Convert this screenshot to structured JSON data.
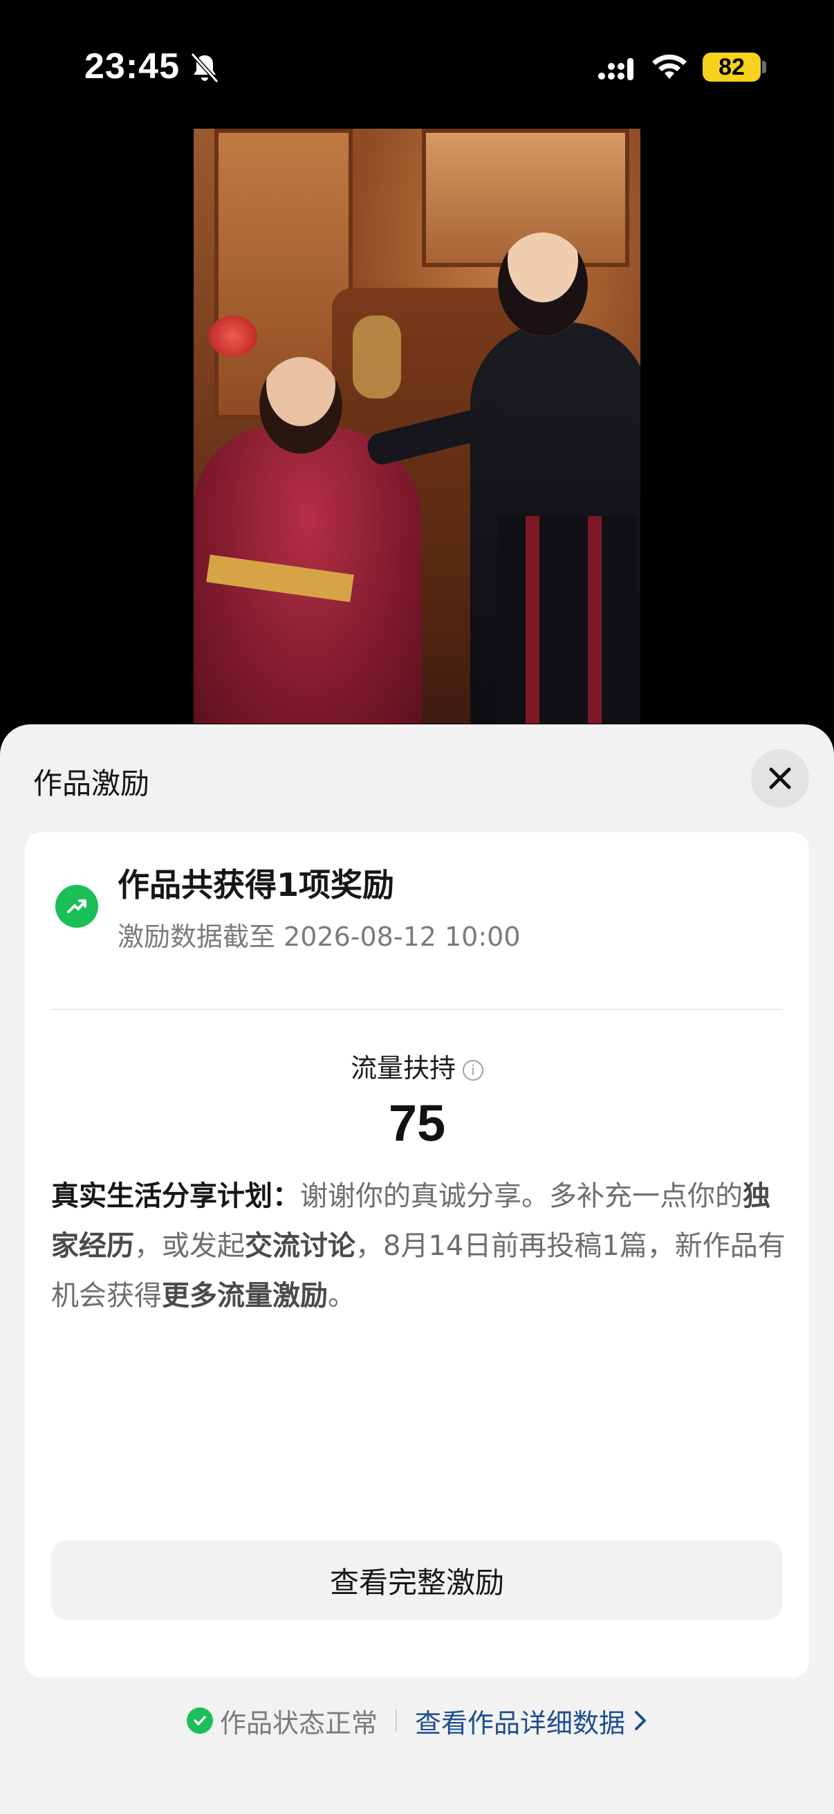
{
  "status_bar": {
    "time": "23:45",
    "battery": "82"
  },
  "sheet": {
    "title": "作品激励",
    "reward": {
      "title": "作品共获得1项奖励",
      "subtitle": "激励数据截至 2026-08-12 10:00"
    },
    "metric": {
      "label": "流量扶持",
      "value": "75"
    },
    "description": {
      "lead": "真实生活分享计划：",
      "t1": "谢谢你的真诚分享。多补充一点你的",
      "b1": "独家经历",
      "t2": "，或发起",
      "b2": "交流讨论",
      "t3": "，8月14日前再投稿1篇，新作品有机会获得",
      "b3": "更多流量激励",
      "t4": "。"
    },
    "full_button": "查看完整激励",
    "footer": {
      "status": "作品状态正常",
      "detail_link": "查看作品详细数据"
    }
  },
  "colors": {
    "accent_green": "#1bbf57",
    "link_blue": "#1f4e8c",
    "battery_yellow": "#f6d21d"
  }
}
